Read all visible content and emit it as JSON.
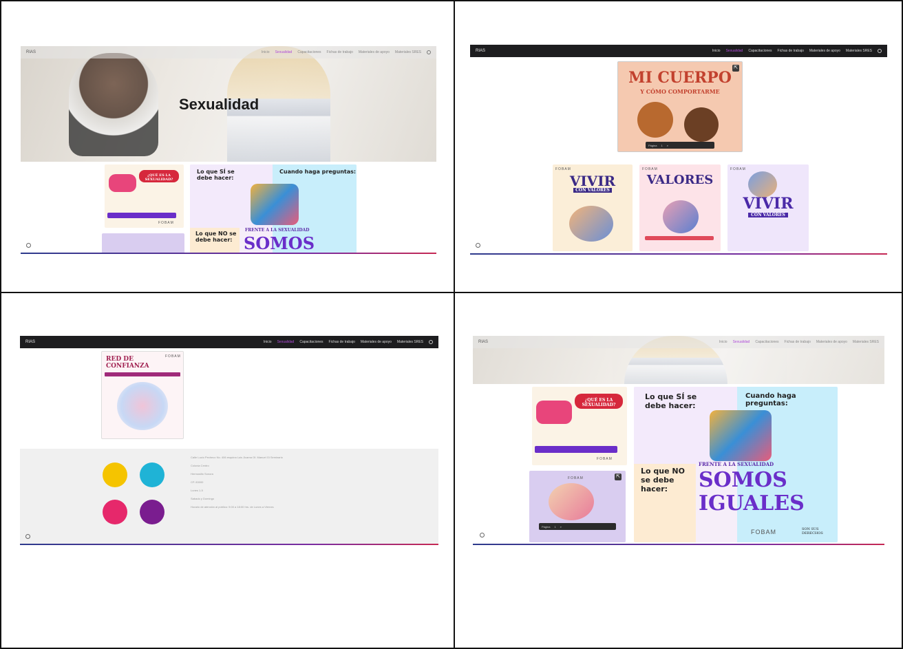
{
  "nav": {
    "brand": "RIAS",
    "items": [
      "Inicio",
      "Sexualidad",
      "Capacitaciones",
      "Fichas de trabajo",
      "Materiales de apoyo",
      "Materiales SRES"
    ],
    "active_index": 1
  },
  "hero": {
    "title": "Sexualidad"
  },
  "posters": {
    "que_es": "¿QUÉ ES LA SEXUALIDAD?",
    "si_title": "Lo que SÍ se debe hacer:",
    "no_title": "Lo que NO se debe hacer:",
    "preguntas_title": "Cuando haga preguntas:",
    "frente": "FRENTE A LA SEXUALIDAD",
    "somos": "SOMOS",
    "iguales": "IGUALES",
    "mi_cuerpo": "MI CUERPO",
    "mi_cuerpo_sub": "Y CÓMO COMPORTARME",
    "vivir": "VIVIR",
    "con_valores": "CON VALORES",
    "valores": "VALORES",
    "red": "RED DE CONFIANZA",
    "fobam": "FOBAM",
    "sus_derechos": "SON SUS DERECHOS"
  },
  "viewer": {
    "page_label": "Página",
    "page_num": "1"
  },
  "footer": {
    "lines": [
      "Calle Lucio Pecheco No. 406 esquina Luis Jicama Of. Manuel Gi Seminario",
      "Colonia Centro",
      "Hermosillo Sonora",
      "CP. 83000",
      "Lunes 1-5",
      "Sabado y Domingo",
      "Horario de atención al público: 9:00 a 18:00 hrs. de Lunes a Viernes"
    ]
  },
  "colors": {
    "nav_bg": "#1d1d1f",
    "accent": "#b04cd9",
    "logo": [
      "#f5c400",
      "#1fb3d6",
      "#e6286b",
      "#7a1d8f"
    ]
  }
}
